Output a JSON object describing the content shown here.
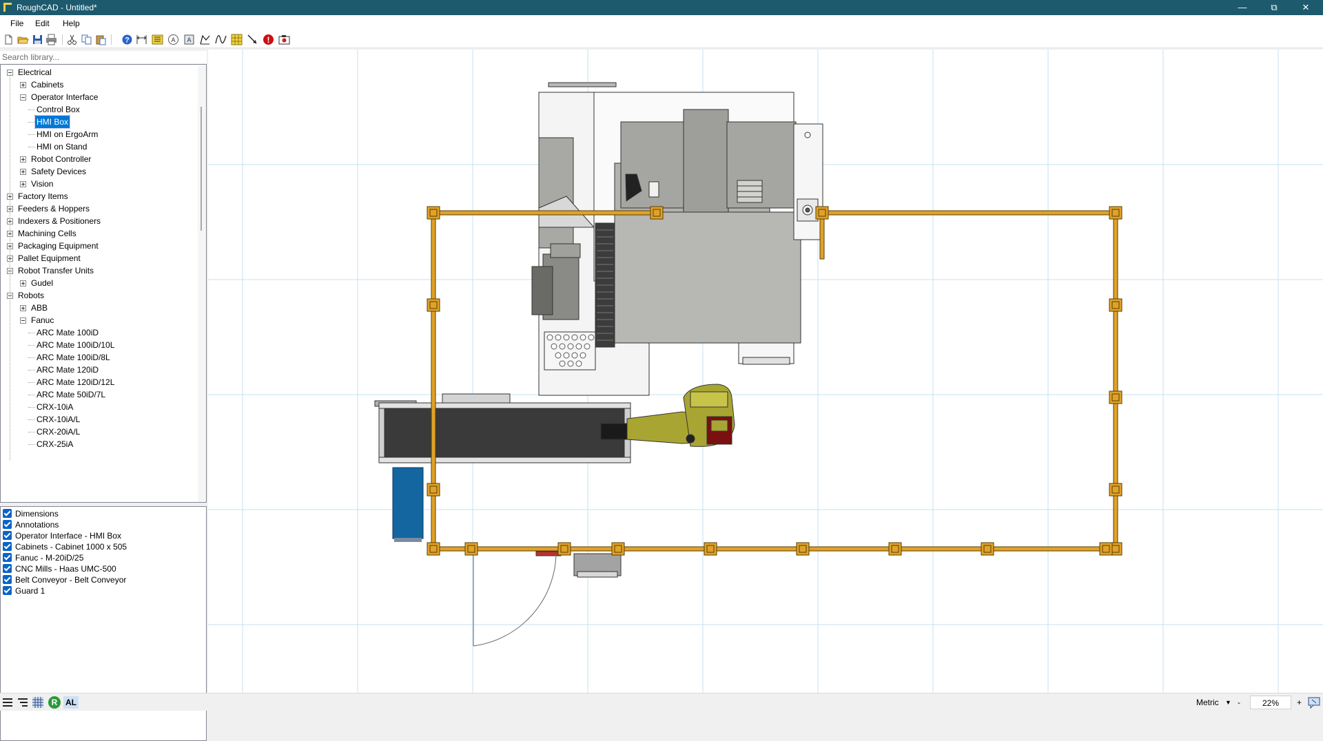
{
  "window": {
    "title": "RoughCAD - Untitled*",
    "controls": {
      "minimize": "—",
      "maximize": "⧉",
      "close": "✕"
    }
  },
  "menu": {
    "file": "File",
    "edit": "Edit",
    "help": "Help"
  },
  "toolbar": {
    "icons": [
      "new-icon",
      "open-icon",
      "save-icon",
      "print-icon",
      "cut-icon",
      "copy-icon",
      "paste-icon",
      "help-icon",
      "dimension-icon",
      "list-icon",
      "circle-a-icon",
      "rect-a-icon",
      "polyline-icon",
      "spline-icon",
      "grid-icon",
      "arrow-line-icon",
      "error-icon",
      "camera-icon"
    ]
  },
  "library": {
    "search_placeholder": "Search library...",
    "tree": [
      {
        "label": "Electrical",
        "level": 0,
        "state": "expanded"
      },
      {
        "label": "Cabinets",
        "level": 1,
        "state": "collapsed"
      },
      {
        "label": "Operator Interface",
        "level": 1,
        "state": "expanded"
      },
      {
        "label": "Control Box",
        "level": 2,
        "state": "leaf"
      },
      {
        "label": "HMI Box",
        "level": 2,
        "state": "leaf",
        "selected": true
      },
      {
        "label": "HMI on ErgoArm",
        "level": 2,
        "state": "leaf"
      },
      {
        "label": "HMI on Stand",
        "level": 2,
        "state": "leaf"
      },
      {
        "label": "Robot Controller",
        "level": 1,
        "state": "collapsed"
      },
      {
        "label": "Safety Devices",
        "level": 1,
        "state": "collapsed"
      },
      {
        "label": "Vision",
        "level": 1,
        "state": "collapsed"
      },
      {
        "label": "Factory Items",
        "level": 0,
        "state": "collapsed"
      },
      {
        "label": "Feeders & Hoppers",
        "level": 0,
        "state": "collapsed"
      },
      {
        "label": "Indexers & Positioners",
        "level": 0,
        "state": "collapsed"
      },
      {
        "label": "Machining Cells",
        "level": 0,
        "state": "collapsed"
      },
      {
        "label": "Packaging Equipment",
        "level": 0,
        "state": "collapsed"
      },
      {
        "label": "Pallet Equipment",
        "level": 0,
        "state": "collapsed"
      },
      {
        "label": "Robot Transfer Units",
        "level": 0,
        "state": "expanded"
      },
      {
        "label": "Gudel",
        "level": 1,
        "state": "collapsed"
      },
      {
        "label": "Robots",
        "level": 0,
        "state": "expanded"
      },
      {
        "label": "ABB",
        "level": 1,
        "state": "collapsed"
      },
      {
        "label": "Fanuc",
        "level": 1,
        "state": "expanded"
      },
      {
        "label": "ARC Mate 100iD",
        "level": 2,
        "state": "leaf"
      },
      {
        "label": "ARC Mate 100iD/10L",
        "level": 2,
        "state": "leaf"
      },
      {
        "label": "ARC Mate 100iD/8L",
        "level": 2,
        "state": "leaf"
      },
      {
        "label": "ARC Mate 120iD",
        "level": 2,
        "state": "leaf"
      },
      {
        "label": "ARC Mate 120iD/12L",
        "level": 2,
        "state": "leaf"
      },
      {
        "label": "ARC Mate 50iD/7L",
        "level": 2,
        "state": "leaf"
      },
      {
        "label": "CRX-10iA",
        "level": 2,
        "state": "leaf"
      },
      {
        "label": "CRX-10iA/L",
        "level": 2,
        "state": "leaf"
      },
      {
        "label": "CRX-20iA/L",
        "level": 2,
        "state": "leaf"
      },
      {
        "label": "CRX-25iA",
        "level": 2,
        "state": "leaf"
      }
    ]
  },
  "layers": [
    {
      "label": "Dimensions",
      "checked": true
    },
    {
      "label": "Annotations",
      "checked": true
    },
    {
      "label": "Operator Interface - HMI Box",
      "checked": true
    },
    {
      "label": "Cabinets - Cabinet 1000 x 505",
      "checked": true
    },
    {
      "label": "Fanuc - M-20iD/25",
      "checked": true
    },
    {
      "label": "CNC Mills - Haas UMC-500",
      "checked": true
    },
    {
      "label": "Belt Conveyor - Belt Conveyor",
      "checked": true
    },
    {
      "label": "Guard 1",
      "checked": true
    }
  ],
  "status": {
    "units": "Metric",
    "zoom": "22%",
    "zoom_minus": "-",
    "zoom_plus": "+",
    "r_badge": "R",
    "al_badge": "AL"
  },
  "colors": {
    "titlebar": "#1d5a6e",
    "selection": "#0078d7",
    "guard": "#e0a22a",
    "robot": "#a9a532",
    "cabinet": "#1466a0",
    "grid": "#c6e0f2"
  }
}
